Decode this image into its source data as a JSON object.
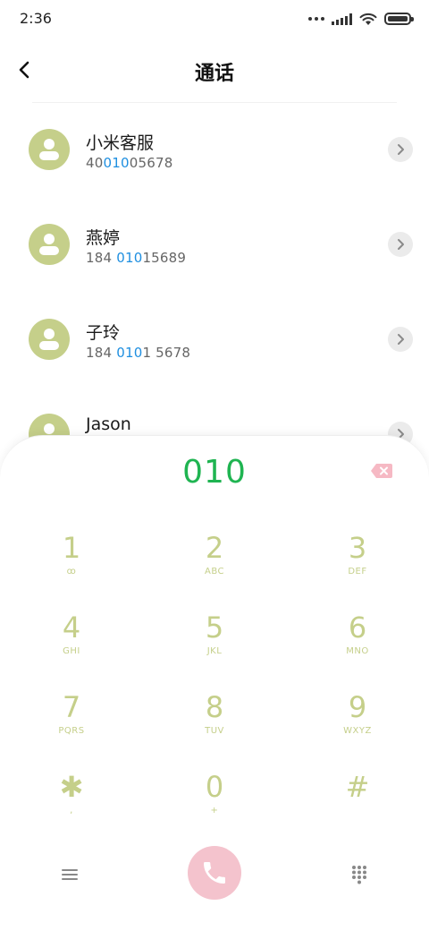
{
  "status_bar": {
    "time": "2:36",
    "icons": [
      "dots-icon",
      "signal-icon",
      "wifi-icon",
      "battery-icon"
    ]
  },
  "header": {
    "title": "通话",
    "back_icon": "chevron-left-icon"
  },
  "contacts": [
    {
      "name": "小米客服",
      "number_parts": [
        "40",
        "010",
        "05678"
      ]
    },
    {
      "name": "燕婷",
      "number_parts": [
        "184 ",
        "010",
        "15689"
      ]
    },
    {
      "name": "子玲",
      "number_parts": [
        "184 ",
        "010",
        "1 5678"
      ]
    },
    {
      "name": "Jason",
      "number_parts": [
        "",
        "",
        ""
      ]
    }
  ],
  "dialpad": {
    "dialed_number": "010",
    "keys": [
      {
        "digit": "1",
        "letters": "ꝏ"
      },
      {
        "digit": "2",
        "letters": "ABC"
      },
      {
        "digit": "3",
        "letters": "DEF"
      },
      {
        "digit": "4",
        "letters": "GHI"
      },
      {
        "digit": "5",
        "letters": "JKL"
      },
      {
        "digit": "6",
        "letters": "MNO"
      },
      {
        "digit": "7",
        "letters": "PQRS"
      },
      {
        "digit": "8",
        "letters": "TUV"
      },
      {
        "digit": "9",
        "letters": "WXYZ"
      },
      {
        "digit": "✱",
        "letters": ","
      },
      {
        "digit": "0",
        "letters": "+"
      },
      {
        "digit": "#",
        "letters": ""
      }
    ]
  },
  "colors": {
    "accent_green": "#1fb451",
    "key_color": "#c5cf8a",
    "highlight_blue": "#1f8fe0",
    "call_button": "#f4c3cd",
    "backspace": "#f6b9c4"
  }
}
